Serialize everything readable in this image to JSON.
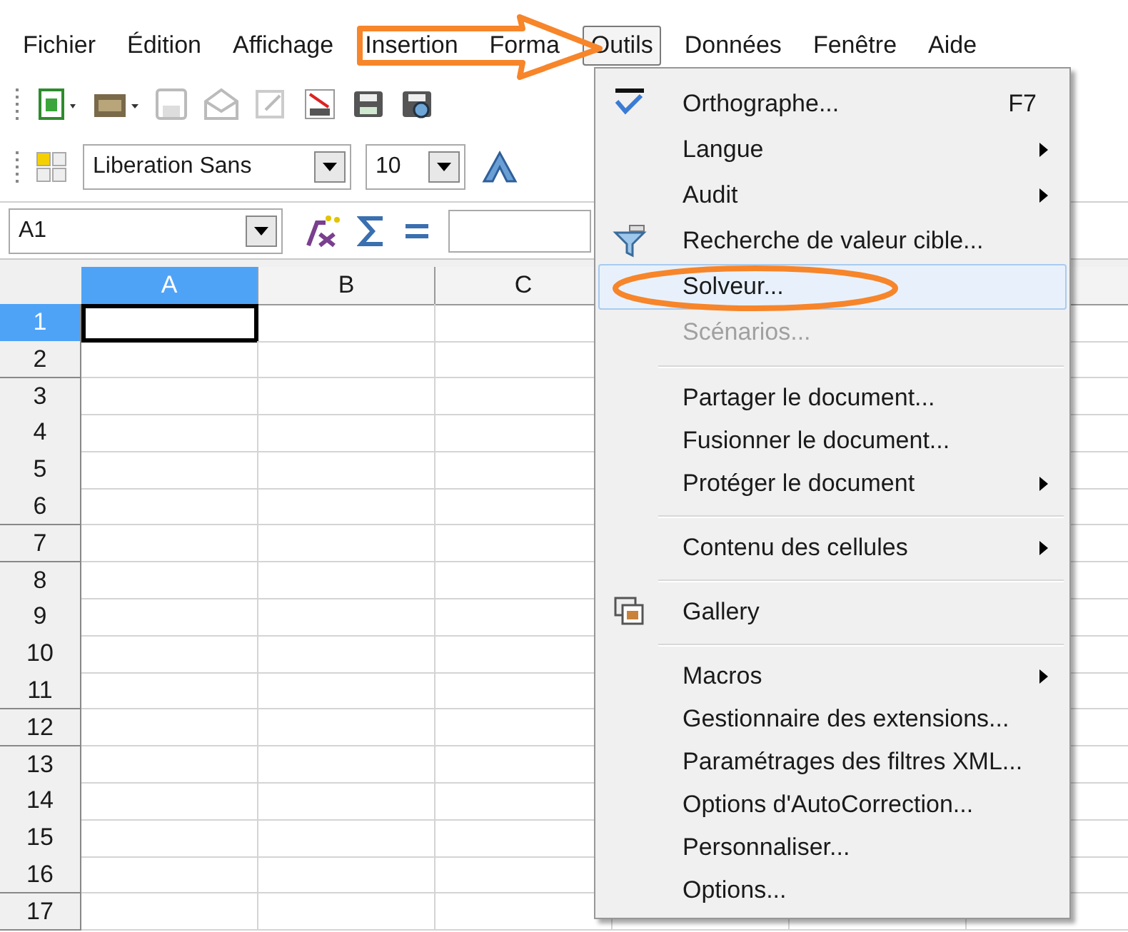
{
  "menubar": [
    {
      "label": "Fichier",
      "selected": false
    },
    {
      "label": "Édition",
      "selected": false
    },
    {
      "label": "Affichage",
      "selected": false
    },
    {
      "label": "Insertion",
      "selected": false
    },
    {
      "label": "Forma",
      "selected": false
    },
    {
      "label": "Outils",
      "selected": true
    },
    {
      "label": "Données",
      "selected": false
    },
    {
      "label": "Fenêtre",
      "selected": false
    },
    {
      "label": "Aide",
      "selected": false
    }
  ],
  "formatting_toolbar": {
    "font_name": "Liberation Sans",
    "font_size": "10"
  },
  "formula_bar": {
    "name_box": "A1"
  },
  "sheet": {
    "columns": [
      {
        "label": "A",
        "selected": true
      },
      {
        "label": "B",
        "selected": false
      },
      {
        "label": "C",
        "selected": false
      }
    ],
    "rows": [
      {
        "label": "1",
        "selected": true
      },
      {
        "label": "2",
        "selected": false
      },
      {
        "label": "3",
        "selected": false
      },
      {
        "label": "4",
        "selected": false
      },
      {
        "label": "5",
        "selected": false
      },
      {
        "label": "6",
        "selected": false
      },
      {
        "label": "7",
        "selected": false
      },
      {
        "label": "8",
        "selected": false
      },
      {
        "label": "9",
        "selected": false
      },
      {
        "label": "10",
        "selected": false
      },
      {
        "label": "11",
        "selected": false
      },
      {
        "label": "12",
        "selected": false
      },
      {
        "label": "13",
        "selected": false
      },
      {
        "label": "14",
        "selected": false
      },
      {
        "label": "15",
        "selected": false
      },
      {
        "label": "16",
        "selected": false
      },
      {
        "label": "17",
        "selected": false
      }
    ]
  },
  "menu": [
    {
      "kind": "item",
      "label": "Orthographe...",
      "shortcut": "F7",
      "icon": true,
      "submenu": false,
      "disabled": false,
      "selected": false
    },
    {
      "kind": "item",
      "label": "Langue",
      "icon": false,
      "submenu": true,
      "disabled": false,
      "selected": false
    },
    {
      "kind": "item",
      "label": "Audit",
      "icon": false,
      "submenu": true,
      "disabled": false,
      "selected": false
    },
    {
      "kind": "item",
      "label": "Recherche de valeur cible...",
      "icon": true,
      "submenu": false,
      "disabled": false,
      "selected": false
    },
    {
      "kind": "item",
      "label": "Solveur...",
      "icon": false,
      "submenu": false,
      "disabled": false,
      "selected": true
    },
    {
      "kind": "item",
      "label": "Scénarios...",
      "icon": false,
      "submenu": false,
      "disabled": true,
      "selected": false
    },
    {
      "kind": "separator"
    },
    {
      "kind": "item",
      "label": "Partager le document...",
      "icon": false,
      "submenu": false,
      "disabled": false,
      "selected": false
    },
    {
      "kind": "item",
      "label": "Fusionner le document...",
      "icon": false,
      "submenu": false,
      "disabled": false,
      "selected": false
    },
    {
      "kind": "item",
      "label": "Protéger le document",
      "icon": false,
      "submenu": true,
      "disabled": false,
      "selected": false
    },
    {
      "kind": "separator"
    },
    {
      "kind": "item",
      "label": "Contenu des cellules",
      "icon": false,
      "submenu": true,
      "disabled": false,
      "selected": false
    },
    {
      "kind": "separator"
    },
    {
      "kind": "item",
      "label": "Gallery",
      "icon": true,
      "submenu": false,
      "disabled": false,
      "selected": false
    },
    {
      "kind": "separator"
    },
    {
      "kind": "item",
      "label": "Macros",
      "icon": false,
      "submenu": true,
      "disabled": false,
      "selected": false
    },
    {
      "kind": "item",
      "label": "Gestionnaire des extensions...",
      "icon": false,
      "submenu": false,
      "disabled": false,
      "selected": false
    },
    {
      "kind": "item",
      "label": "Paramétrages des filtres XML...",
      "icon": false,
      "submenu": false,
      "disabled": false,
      "selected": false
    },
    {
      "kind": "item",
      "label": "Options d'AutoCorrection...",
      "icon": false,
      "submenu": false,
      "disabled": false,
      "selected": false
    },
    {
      "kind": "item",
      "label": "Personnaliser...",
      "icon": false,
      "submenu": false,
      "disabled": false,
      "selected": false
    },
    {
      "kind": "item",
      "label": "Options...",
      "icon": false,
      "submenu": false,
      "disabled": false,
      "selected": false
    }
  ]
}
